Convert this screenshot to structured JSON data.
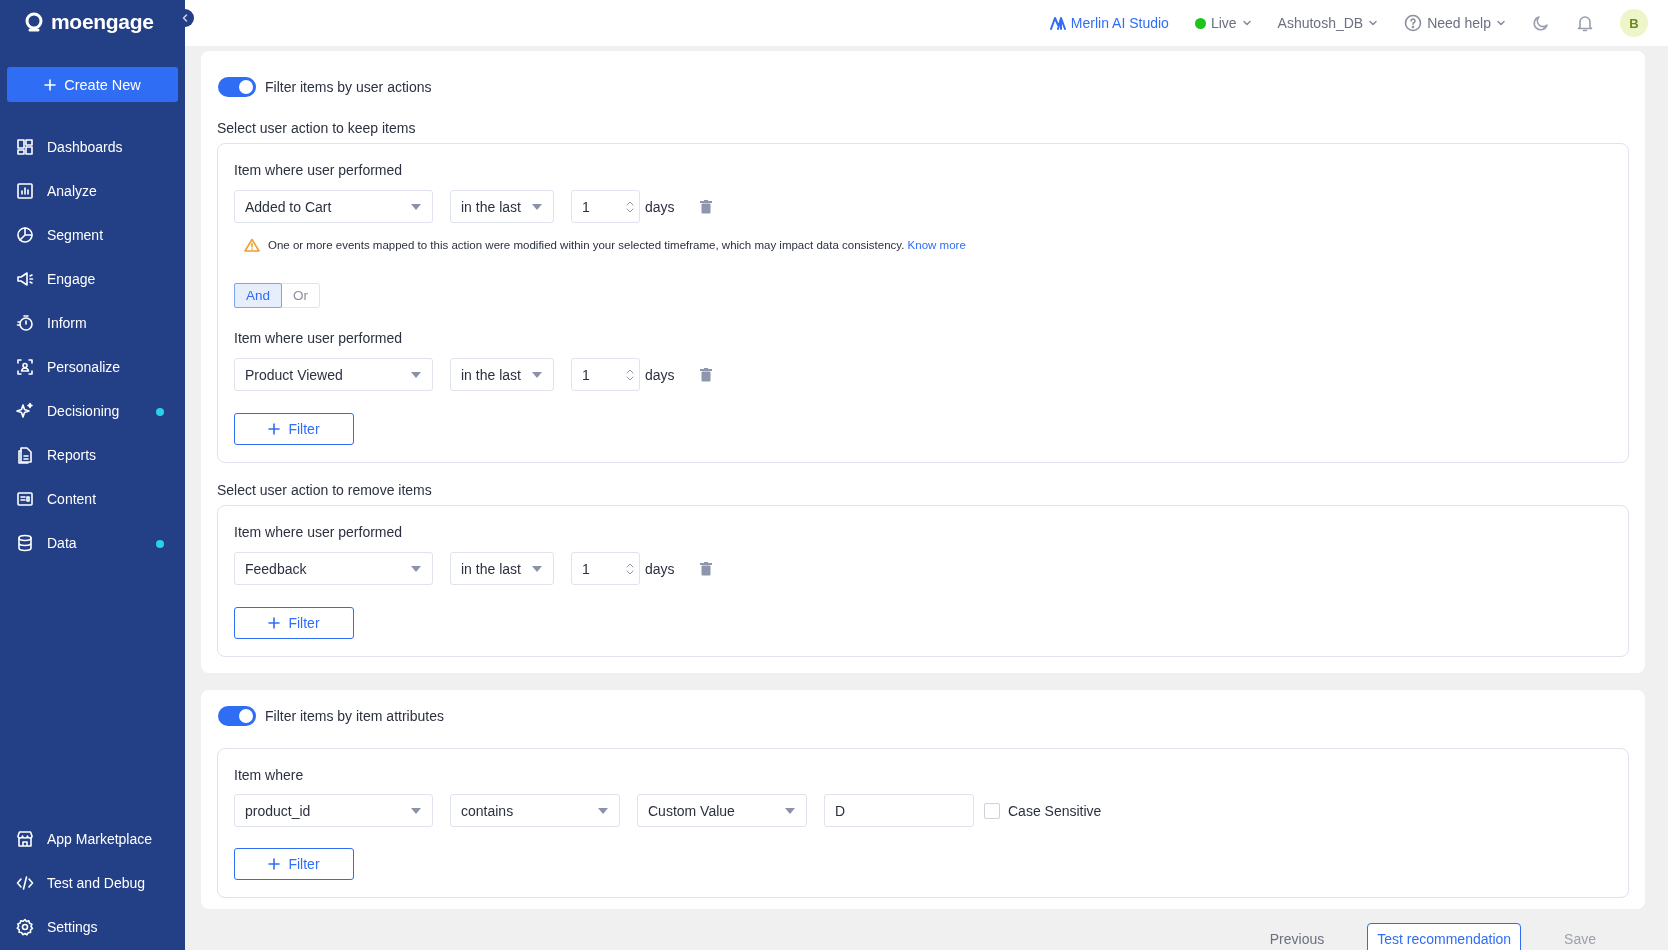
{
  "sidebar": {
    "logo": "moengage",
    "create_button": "Create New",
    "items": [
      {
        "label": "Dashboards",
        "notification_dot": false
      },
      {
        "label": "Analyze",
        "notification_dot": false
      },
      {
        "label": "Segment",
        "notification_dot": false
      },
      {
        "label": "Engage",
        "notification_dot": false
      },
      {
        "label": "Inform",
        "notification_dot": false
      },
      {
        "label": "Personalize",
        "notification_dot": false
      },
      {
        "label": "Decisioning",
        "notification_dot": true
      },
      {
        "label": "Reports",
        "notification_dot": false
      },
      {
        "label": "Content",
        "notification_dot": false
      },
      {
        "label": "Data",
        "notification_dot": true
      }
    ],
    "bottom_items": [
      {
        "label": "App Marketplace"
      },
      {
        "label": "Test and Debug"
      },
      {
        "label": "Settings"
      }
    ]
  },
  "topbar": {
    "ai_studio": "Merlin AI Studio",
    "environment": {
      "label": "Live",
      "color": "#1ec31e"
    },
    "workspace": "Ashutosh_DB",
    "help": "Need help",
    "avatar": "B"
  },
  "user_actions": {
    "toggle": {
      "label": "Filter items by user actions",
      "on": true
    },
    "groups": [
      {
        "title": "Select user action to keep items",
        "add_filter": "Filter",
        "items": [
          {
            "kind": "condition",
            "label": "Item where user performed",
            "event": "Added to Cart",
            "range": "in the last",
            "value": "1",
            "unit": "days"
          },
          {
            "kind": "warning",
            "text": "One or more events mapped to this action were modified within your selected timeframe, which may impact data consistency.",
            "link": "Know more"
          },
          {
            "kind": "connector",
            "options": [
              {
                "label": "And",
                "selected": true
              },
              {
                "label": "Or",
                "selected": false
              }
            ]
          },
          {
            "kind": "condition",
            "label": "Item where user performed",
            "event": "Product Viewed",
            "range": "in the last",
            "value": "1",
            "unit": "days"
          }
        ]
      },
      {
        "title": "Select user action to remove items",
        "add_filter": "Filter",
        "items": [
          {
            "kind": "condition",
            "label": "Item where user performed",
            "event": "Feedback",
            "range": "in the last",
            "value": "1",
            "unit": "days"
          }
        ]
      }
    ]
  },
  "item_attributes": {
    "toggle": {
      "label": "Filter items by item attributes",
      "on": true
    },
    "label": "Item where",
    "attribute": "product_id",
    "operator": "contains",
    "value_type": "Custom Value",
    "value": "D",
    "case_sensitive": {
      "label": "Case Sensitive",
      "checked": false
    },
    "add_filter": "Filter"
  },
  "footer": {
    "previous": "Previous",
    "test": "Test recommendation",
    "save": {
      "label": "Save",
      "disabled": true
    }
  }
}
